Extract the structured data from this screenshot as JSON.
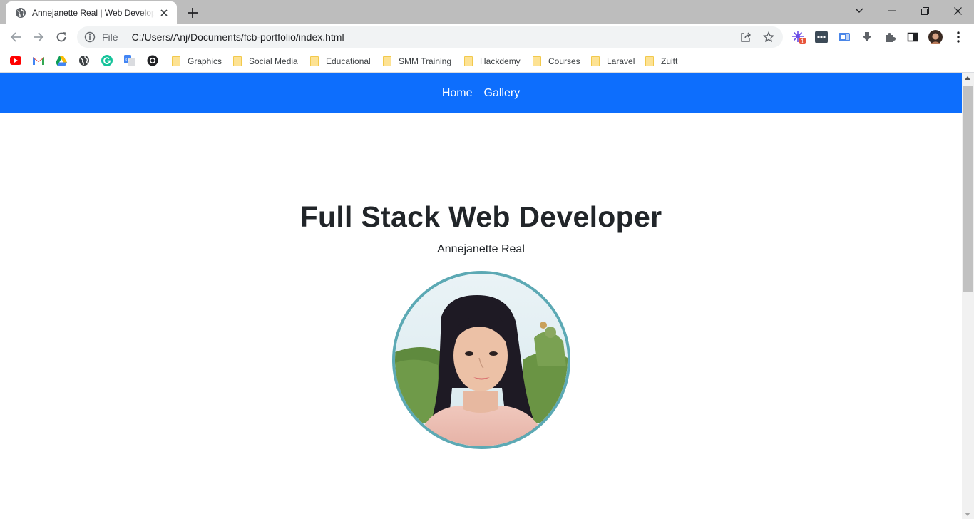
{
  "browser": {
    "tab": {
      "title": "Annejanette Real | Web Developer"
    },
    "address": {
      "scheme": "File",
      "url": "C:/Users/Anj/Documents/fcb-portfolio/index.html"
    },
    "extensions": {
      "badge_count": "1"
    },
    "bookmarks": {
      "folders": [
        {
          "label": "Graphics"
        },
        {
          "label": "Social Media"
        },
        {
          "label": "Educational"
        },
        {
          "label": "SMM Training"
        },
        {
          "label": "Hackdemy"
        },
        {
          "label": "Courses"
        },
        {
          "label": "Laravel"
        },
        {
          "label": "Zuitt"
        }
      ]
    }
  },
  "site": {
    "nav": {
      "home": "Home",
      "gallery": "Gallery"
    },
    "hero": {
      "title": "Full Stack Web Developer",
      "name": "Annejanette Real"
    }
  },
  "colors": {
    "navbar_bg": "#0d6efd",
    "avatar_border": "#5ca9b4",
    "text_dark": "#212529"
  },
  "icons": {
    "tab_favicon": "globe-icon",
    "back": "arrow-left-icon",
    "forward": "arrow-right-icon",
    "reload": "reload-icon",
    "site_info": "info-icon",
    "share": "share-icon",
    "bookmark_star": "star-icon",
    "menu": "kebab-menu-icon"
  }
}
